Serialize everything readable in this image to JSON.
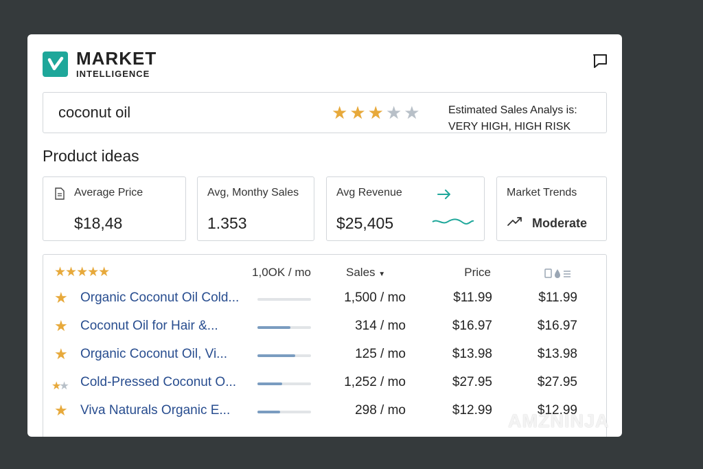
{
  "brand": {
    "title": "MARKET",
    "subtitle": "INTELLIGENCE"
  },
  "search": {
    "value": "coconut oil",
    "rating": {
      "value": 3,
      "max": 5
    },
    "estimate_label": "Estimated Sales Analys is:",
    "estimate_value": "VERY HIGH, HIGH RISK"
  },
  "section_title": "Product ideas",
  "metrics": {
    "avg_price": {
      "label": "Average Price",
      "value": "$18,48"
    },
    "monthly_sales": {
      "label": "Avg, Monthy Sales",
      "value": "1.353"
    },
    "avg_revenue": {
      "label": "Avg Revenue",
      "value": "$25,405"
    },
    "market_trends": {
      "label": "Market Trends",
      "value": "Moderate"
    }
  },
  "table": {
    "header_rating": 5,
    "columns": {
      "volume": "1,0OK / mo",
      "sales": "Sales",
      "price": "Price"
    },
    "rows": [
      {
        "name": "Organic Coconut Oil Cold...",
        "stars": 1,
        "fill": 0.0,
        "sales": "1,500 / mo",
        "price": "$11.99",
        "price2": "$11.99"
      },
      {
        "name": "Coconut Oil for Hair &...",
        "stars": 1,
        "fill": 0.62,
        "sales": "314 / mo",
        "price": "$16.97",
        "price2": "$16.97"
      },
      {
        "name": "Organic Coconut Oil, Vi...",
        "stars": 1,
        "fill": 0.7,
        "sales": "125 / mo",
        "price": "$13.98",
        "price2": "$13.98"
      },
      {
        "name": "Cold-Pressed Coconut O...",
        "stars": 1.5,
        "fill": 0.46,
        "sales": "1,252 / mo",
        "price": "$27.95",
        "price2": "$27.95"
      },
      {
        "name": "Viva Naturals Organic E...",
        "stars": 1,
        "fill": 0.42,
        "sales": "298 / mo",
        "price": "$12.99",
        "price2": "$12.99"
      }
    ]
  },
  "watermark": "AMZNINJA",
  "colors": {
    "accent": "#1ea79a",
    "star": "#e7a93b",
    "link": "#284d8f"
  },
  "icons": [
    "check-icon",
    "bookmark-icon",
    "document-icon",
    "arrow-right-icon",
    "trend-up-icon",
    "sort-down-icon"
  ]
}
